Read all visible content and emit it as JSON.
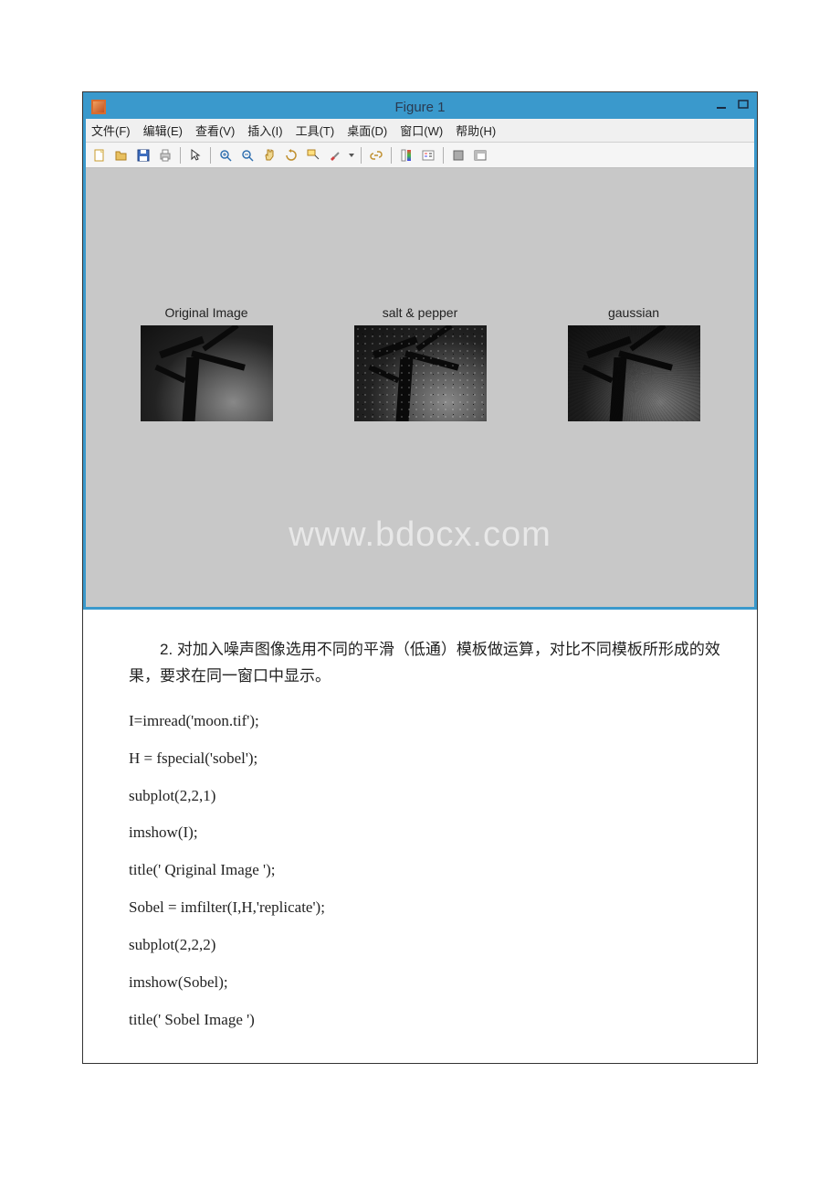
{
  "window": {
    "title": "Figure 1"
  },
  "menubar": {
    "file": "文件(F)",
    "edit": "编辑(E)",
    "view": "查看(V)",
    "insert": "插入(I)",
    "tools": "工具(T)",
    "desktop": "桌面(D)",
    "window": "窗口(W)",
    "help": "帮助(H)"
  },
  "figure": {
    "watermark": "www.bdocx.com",
    "subplots": {
      "s1": {
        "title": "Original Image"
      },
      "s2": {
        "title": "salt & pepper"
      },
      "s3": {
        "title": "gaussian"
      }
    }
  },
  "doc": {
    "q2": "2. 对加入噪声图像选用不同的平滑（低通）模板做运算，对比不同模板所形成的效果，要求在同一窗口中显示。",
    "code": {
      "l1": "I=imread('moon.tif');",
      "l2": "H = fspecial('sobel');",
      "l3": "subplot(2,2,1)",
      "l4": "imshow(I);",
      "l5": "title(' Qriginal Image ');",
      "l6": "Sobel = imfilter(I,H,'replicate');",
      "l7": "subplot(2,2,2)",
      "l8": "imshow(Sobel);",
      "l9": "title(' Sobel Image ')"
    }
  }
}
